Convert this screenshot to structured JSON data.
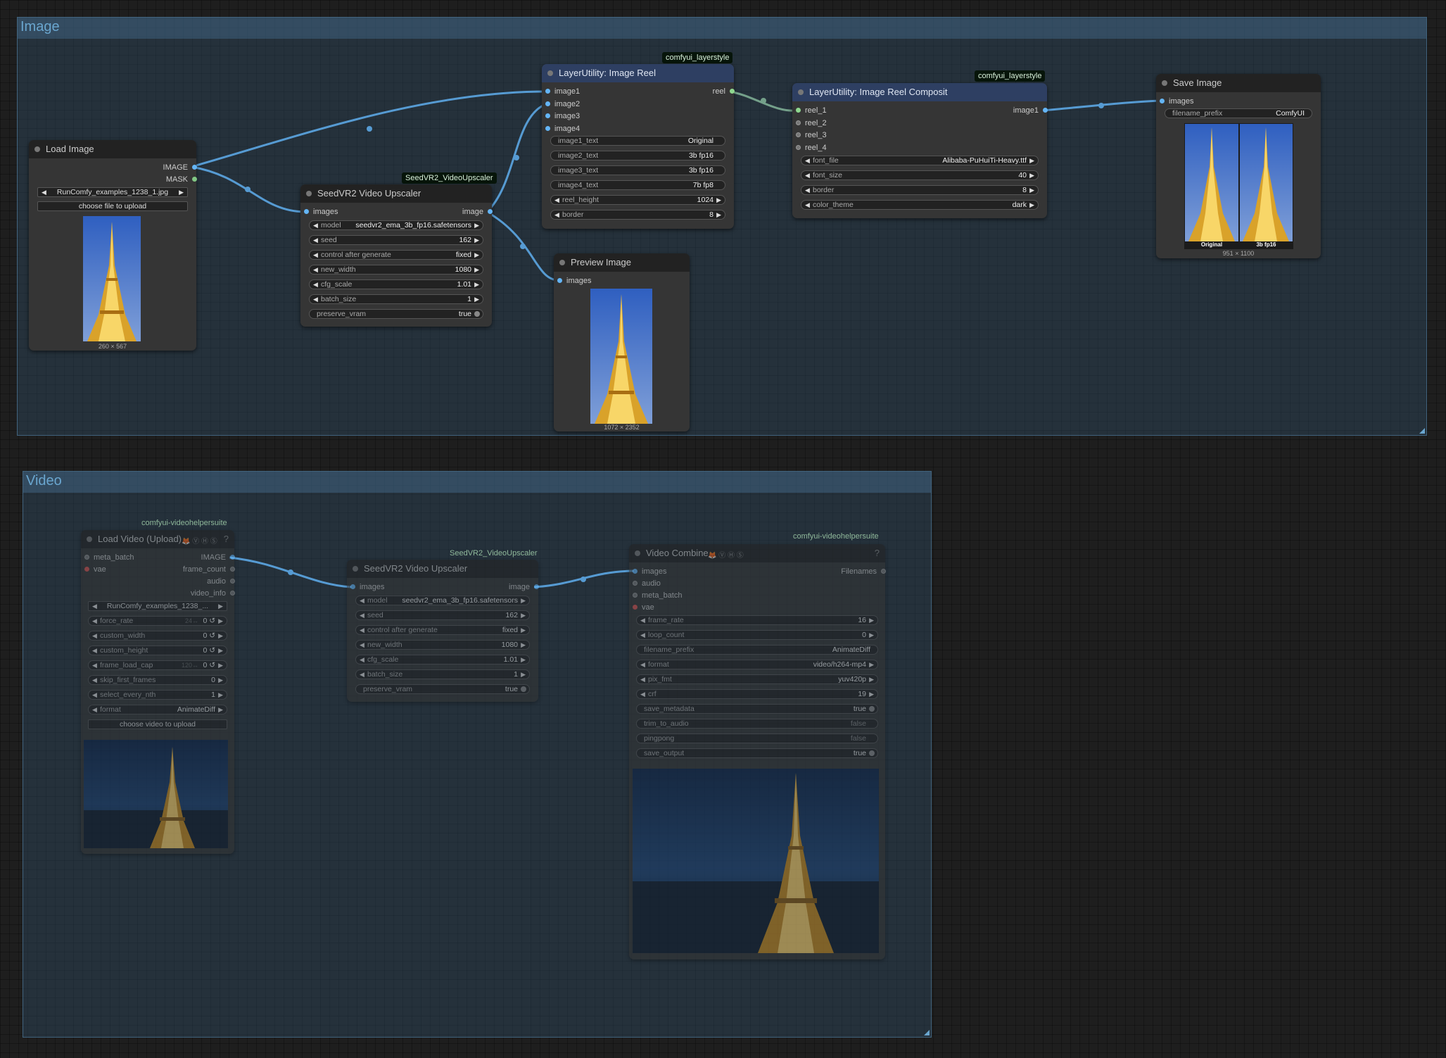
{
  "groups": {
    "image": {
      "title": "Image"
    },
    "video": {
      "title": "Video"
    }
  },
  "load_image": {
    "title": "Load Image",
    "outputs": [
      "IMAGE",
      "MASK"
    ],
    "file": "RunComfy_examples_1238_1.jpg",
    "upload_button": "choose file to upload",
    "dims": "260 × 567"
  },
  "seedvr2_image": {
    "badge": "SeedVR2_VideoUpscaler",
    "title": "SeedVR2 Video Upscaler",
    "input": "images",
    "output": "image",
    "widgets": [
      {
        "label": "model",
        "value": "seedvr2_ema_3b_fp16.safetensors"
      },
      {
        "label": "seed",
        "value": "162"
      },
      {
        "label": "control after generate",
        "value": "fixed"
      },
      {
        "label": "new_width",
        "value": "1080"
      },
      {
        "label": "cfg_scale",
        "value": "1.01"
      },
      {
        "label": "batch_size",
        "value": "1"
      },
      {
        "label": "preserve_vram",
        "value": "true"
      }
    ]
  },
  "image_reel": {
    "badge": "comfyui_layerstyle",
    "title": "LayerUtility: Image Reel",
    "inputs": [
      "image1",
      "image2",
      "image3",
      "image4"
    ],
    "output": "reel",
    "widgets": [
      {
        "label": "image1_text",
        "value": "Original"
      },
      {
        "label": "image2_text",
        "value": "3b fp16"
      },
      {
        "label": "image3_text",
        "value": "3b fp16"
      },
      {
        "label": "image4_text",
        "value": "7b fp8"
      },
      {
        "label": "reel_height",
        "value": "1024"
      },
      {
        "label": "border",
        "value": "8"
      }
    ]
  },
  "preview_image": {
    "title": "Preview Image",
    "input": "images",
    "dims": "1072 × 2352"
  },
  "reel_composit": {
    "badge": "comfyui_layerstyle",
    "title": "LayerUtility: Image Reel Composit",
    "inputs": [
      "reel_1",
      "reel_2",
      "reel_3",
      "reel_4"
    ],
    "output": "image1",
    "widgets": [
      {
        "label": "font_file",
        "value": "Alibaba-PuHuiTi-Heavy.ttf"
      },
      {
        "label": "font_size",
        "value": "40"
      },
      {
        "label": "border",
        "value": "8"
      },
      {
        "label": "color_theme",
        "value": "dark"
      }
    ]
  },
  "save_image": {
    "title": "Save Image",
    "input": "images",
    "prefix_label": "filename_prefix",
    "prefix_value": "ComfyUI",
    "caption_left": "Original",
    "caption_right": "3b fp16",
    "dims": "951 × 1100"
  },
  "load_video": {
    "badge": "comfyui-videohelpersuite",
    "title": "Load Video (Upload)",
    "vhs_icons": "🦊 Ⓥ Ⓗ Ⓢ",
    "help": "?",
    "inputs": [
      "meta_batch",
      "vae"
    ],
    "outputs": [
      "IMAGE",
      "frame_count",
      "audio",
      "video_info"
    ],
    "file": "RunComfy_examples_1238_...",
    "widgets": [
      {
        "label": "force_rate",
        "hint": "24↔",
        "value": "0 ↺"
      },
      {
        "label": "custom_width",
        "value": "0 ↺"
      },
      {
        "label": "custom_height",
        "value": "0 ↺"
      },
      {
        "label": "frame_load_cap",
        "hint": "120↔",
        "value": "0 ↺"
      },
      {
        "label": "skip_first_frames",
        "value": "0"
      },
      {
        "label": "select_every_nth",
        "value": "1"
      },
      {
        "label": "format",
        "value": "AnimateDiff"
      }
    ],
    "upload_button": "choose video to upload"
  },
  "seedvr2_video": {
    "badge": "SeedVR2_VideoUpscaler",
    "title": "SeedVR2 Video Upscaler",
    "input": "images",
    "output": "image",
    "widgets": [
      {
        "label": "model",
        "value": "seedvr2_ema_3b_fp16.safetensors"
      },
      {
        "label": "seed",
        "value": "162"
      },
      {
        "label": "control after generate",
        "value": "fixed"
      },
      {
        "label": "new_width",
        "value": "1080"
      },
      {
        "label": "cfg_scale",
        "value": "1.01"
      },
      {
        "label": "batch_size",
        "value": "1"
      },
      {
        "label": "preserve_vram",
        "value": "true"
      }
    ]
  },
  "video_combine": {
    "badge": "comfyui-videohelpersuite",
    "title": "Video Combine",
    "vhs_icons": "🦊 Ⓥ Ⓗ Ⓢ",
    "help": "?",
    "inputs": [
      "images",
      "audio",
      "meta_batch",
      "vae"
    ],
    "output": "Filenames",
    "widgets": [
      {
        "label": "frame_rate",
        "value": "16"
      },
      {
        "label": "loop_count",
        "value": "0"
      },
      {
        "label": "filename_prefix",
        "value": "AnimateDiff"
      },
      {
        "label": "format",
        "value": "video/h264-mp4"
      },
      {
        "label": "pix_fmt",
        "value": "yuv420p"
      },
      {
        "label": "crf",
        "value": "19"
      },
      {
        "label": "save_metadata",
        "value": "true"
      },
      {
        "label": "trim_to_audio",
        "value": "false"
      },
      {
        "label": "pingpong",
        "value": "false"
      },
      {
        "label": "save_output",
        "value": "true"
      }
    ]
  },
  "colors": {
    "image_link": "#64b5f6",
    "reel_link": "#8fbc8f",
    "group_title": "#6aa6cf"
  }
}
